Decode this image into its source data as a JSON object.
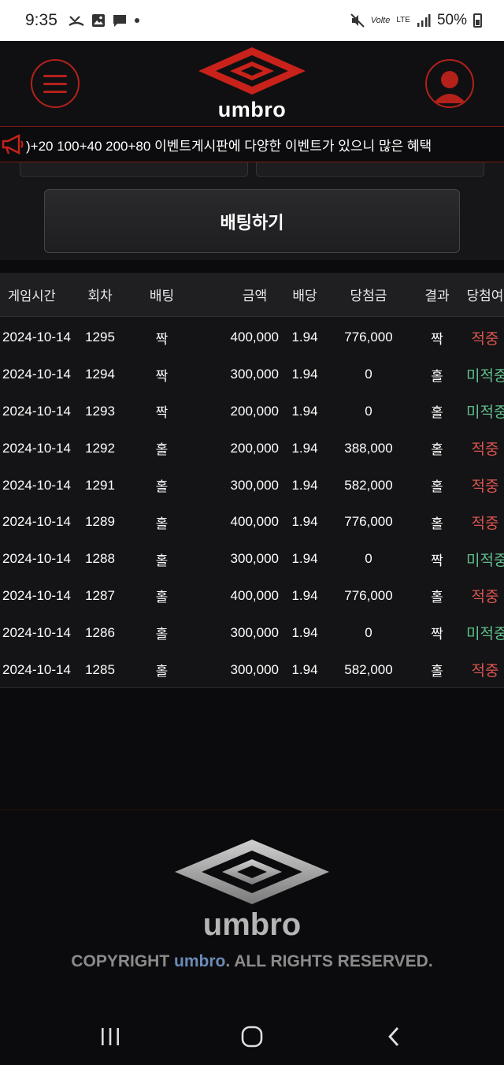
{
  "status_bar": {
    "time": "9:35",
    "network_top": "LTE",
    "wifi_label": "Volte",
    "battery": "50%"
  },
  "header": {
    "logo_text": "umbro",
    "menu_icon": "hamburger-icon",
    "user_icon": "user-icon"
  },
  "ticker": {
    "text": ")+20 100+40 200+80 이벤트게시판에 다양한 이벤트가 있으니 많은 혜택"
  },
  "bet_button": {
    "label": "배팅하기"
  },
  "table": {
    "headers": [
      "게임시간",
      "회차",
      "배팅",
      "금액",
      "배당",
      "당첨금",
      "결과",
      "당첨여"
    ],
    "rows": [
      {
        "date": "2024-10-14",
        "round": "1295",
        "bet": "짝",
        "amount": "400,000",
        "odds": "1.94",
        "payout": "776,000",
        "result": "짝",
        "status": "적중",
        "win": true
      },
      {
        "date": "2024-10-14",
        "round": "1294",
        "bet": "짝",
        "amount": "300,000",
        "odds": "1.94",
        "payout": "0",
        "result": "홀",
        "status": "미적중",
        "win": false
      },
      {
        "date": "2024-10-14",
        "round": "1293",
        "bet": "짝",
        "amount": "200,000",
        "odds": "1.94",
        "payout": "0",
        "result": "홀",
        "status": "미적중",
        "win": false
      },
      {
        "date": "2024-10-14",
        "round": "1292",
        "bet": "홀",
        "amount": "200,000",
        "odds": "1.94",
        "payout": "388,000",
        "result": "홀",
        "status": "적중",
        "win": true
      },
      {
        "date": "2024-10-14",
        "round": "1291",
        "bet": "홀",
        "amount": "300,000",
        "odds": "1.94",
        "payout": "582,000",
        "result": "홀",
        "status": "적중",
        "win": true
      },
      {
        "date": "2024-10-14",
        "round": "1289",
        "bet": "홀",
        "amount": "400,000",
        "odds": "1.94",
        "payout": "776,000",
        "result": "홀",
        "status": "적중",
        "win": true
      },
      {
        "date": "2024-10-14",
        "round": "1288",
        "bet": "홀",
        "amount": "300,000",
        "odds": "1.94",
        "payout": "0",
        "result": "짝",
        "status": "미적중",
        "win": false
      },
      {
        "date": "2024-10-14",
        "round": "1287",
        "bet": "홀",
        "amount": "400,000",
        "odds": "1.94",
        "payout": "776,000",
        "result": "홀",
        "status": "적중",
        "win": true
      },
      {
        "date": "2024-10-14",
        "round": "1286",
        "bet": "홀",
        "amount": "300,000",
        "odds": "1.94",
        "payout": "0",
        "result": "짝",
        "status": "미적중",
        "win": false
      },
      {
        "date": "2024-10-14",
        "round": "1285",
        "bet": "홀",
        "amount": "300,000",
        "odds": "1.94",
        "payout": "582,000",
        "result": "홀",
        "status": "적중",
        "win": true
      }
    ]
  },
  "footer": {
    "logo_text": "umbro",
    "copyright_prefix": "COPYRIGHT ",
    "copyright_brand": "umbro",
    "copyright_suffix": ". ALL RIGHTS RESERVED."
  },
  "colors": {
    "accent_red": "#b3211a",
    "win": "#d9544f",
    "lose": "#5fbf8c",
    "brand_blue": "#6b8bb8"
  }
}
